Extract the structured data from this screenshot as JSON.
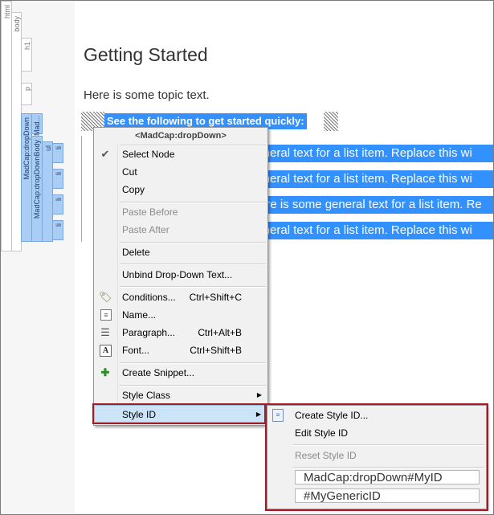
{
  "structure_bars": {
    "html": "html",
    "body": "body",
    "h1": "h1",
    "p": "p",
    "dropdown": "MadCap:dropDown",
    "dropdown_head": "Mad...",
    "dropdown_body": "MadCap:dropDownBody",
    "ul": "ul",
    "li": "li"
  },
  "document": {
    "heading": "Getting Started",
    "paragraph": "Here is some topic text.",
    "selected_line": "See the following to get started quickly:",
    "list_items": [
      "general text for a list item. Replace this wi",
      "general text for a list item. Replace this wi",
      "ere is some general text for a list item. Re",
      "general text for a list item. Replace this wi"
    ]
  },
  "context_menu": {
    "title": "<MadCap:dropDown>",
    "items": {
      "select_node": "Select Node",
      "cut": "Cut",
      "copy": "Copy",
      "paste_before": "Paste Before",
      "paste_after": "Paste After",
      "delete": "Delete",
      "unbind": "Unbind Drop-Down Text...",
      "conditions": "Conditions...",
      "conditions_sc": "Ctrl+Shift+C",
      "name": "Name...",
      "paragraph": "Paragraph...",
      "paragraph_sc": "Ctrl+Alt+B",
      "font": "Font...",
      "font_sc": "Ctrl+Shift+B",
      "create_snippet": "Create Snippet...",
      "style_class": "Style Class",
      "style_id": "Style ID"
    }
  },
  "submenu": {
    "create_style_id": "Create Style ID...",
    "edit_style_id": "Edit Style ID",
    "reset_style_id": "Reset Style ID",
    "option1": "MadCap:dropDown#MyID",
    "option2": "#MyGenericID"
  },
  "colors": {
    "selection": "#3390ff",
    "highlight_outline": "#a31b24",
    "structure_blue": "#a9cdf5"
  }
}
